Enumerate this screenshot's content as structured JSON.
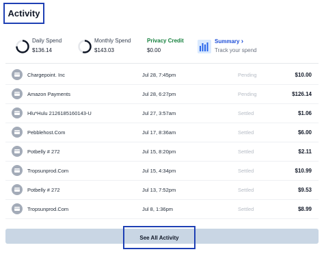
{
  "header": {
    "title": "Activity"
  },
  "summary": {
    "daily": {
      "label": "Daily Spend",
      "value": "$136.14",
      "ring_fraction": 0.75
    },
    "monthly": {
      "label": "Monthly Spend",
      "value": "$143.03",
      "ring_fraction": 0.55
    },
    "privacy": {
      "label": "Privacy Credit",
      "value": "$0.00"
    },
    "link": {
      "label": "Summary",
      "chevron": "›",
      "subtitle": "Track your spend",
      "icon": "bar-chart-icon"
    }
  },
  "transactions": [
    {
      "merchant": "Chargepoint. Inc",
      "date": "Jul 28, 7:45pm",
      "status": "Pending",
      "amount": "$10.00"
    },
    {
      "merchant": "Amazon Payments",
      "date": "Jul 28, 6:27pm",
      "status": "Pending",
      "amount": "$126.14"
    },
    {
      "merchant": "Hlu*Hulu 2126185160143-U",
      "date": "Jul 27, 3:57am",
      "status": "Settled",
      "amount": "$1.06"
    },
    {
      "merchant": "Pebblehost.Com",
      "date": "Jul 17, 8:36am",
      "status": "Settled",
      "amount": "$6.00"
    },
    {
      "merchant": "Potbelly # 272",
      "date": "Jul 15, 8:20pm",
      "status": "Settled",
      "amount": "$2.11"
    },
    {
      "merchant": "Tropsunprod.Com",
      "date": "Jul 15, 4:34pm",
      "status": "Settled",
      "amount": "$10.99"
    },
    {
      "merchant": "Potbelly # 272",
      "date": "Jul 13, 7:52pm",
      "status": "Settled",
      "amount": "$9.53"
    },
    {
      "merchant": "Tropsunprod.Com",
      "date": "Jul 8, 1:36pm",
      "status": "Settled",
      "amount": "$8.99"
    }
  ],
  "footer": {
    "see_all_label": "See All Activity"
  },
  "colors": {
    "accent": "#1e3fb4",
    "privacy": "#15803d",
    "link": "#1d4ed8",
    "button_bg": "#c9d6e4"
  }
}
